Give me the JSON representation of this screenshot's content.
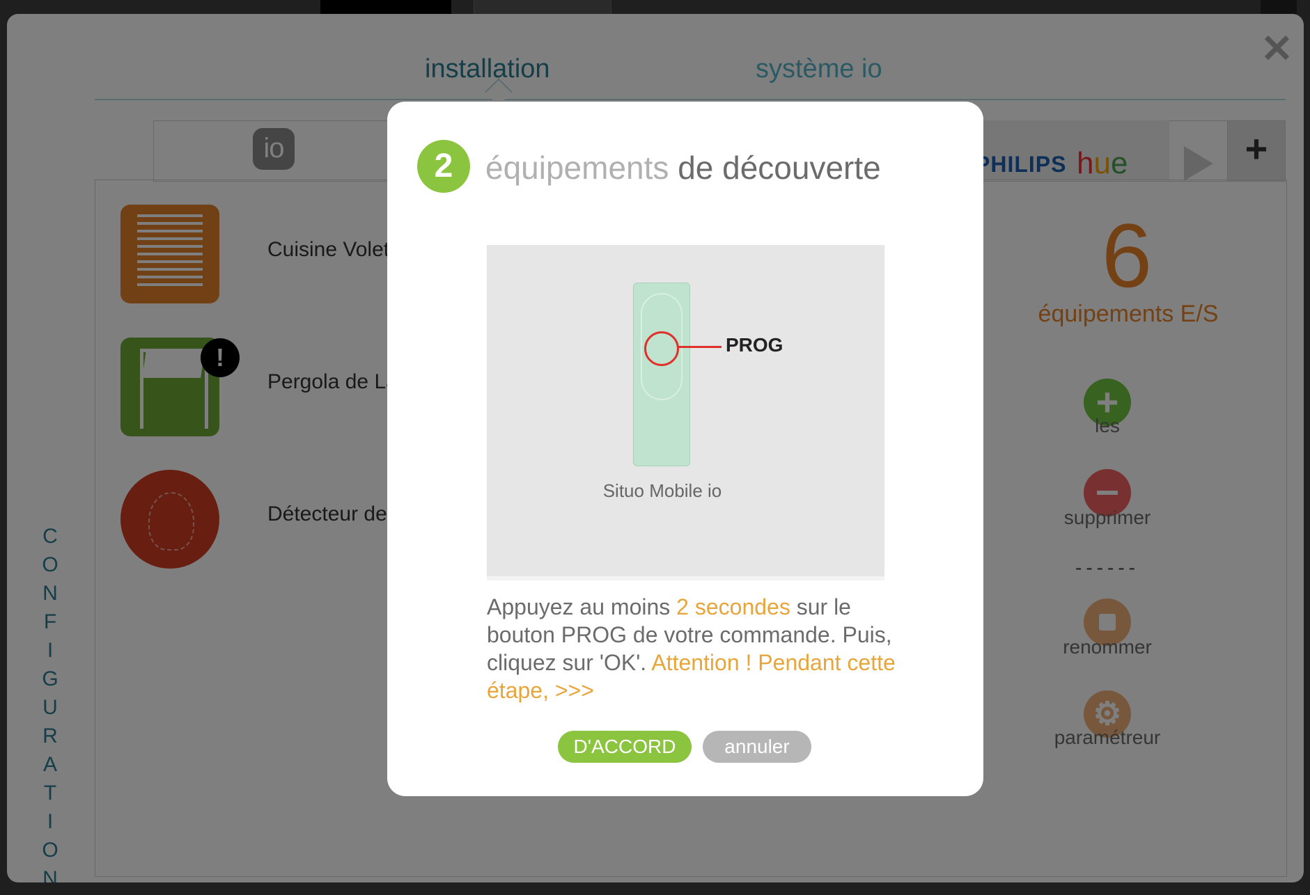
{
  "tabs": {
    "installation": "installation",
    "system": "système io"
  },
  "protocols": {
    "io_logo": "io",
    "philips": "PHILIPS",
    "hue": [
      "h",
      "u",
      "e"
    ],
    "add": "+"
  },
  "sidebar_vertical": [
    "C",
    "O",
    "N",
    "F",
    "I",
    "G",
    "U",
    "R",
    "A",
    "T",
    "I",
    "O",
    "N"
  ],
  "devices": [
    {
      "label": "Cuisine Volet"
    },
    {
      "label": "Pergola de La"
    },
    {
      "label": "Détecteur de"
    }
  ],
  "badge": "!",
  "summary": {
    "count": "6",
    "label": "équipements E/S"
  },
  "actions": {
    "add_label": "les",
    "delete_label": "supprimer",
    "separator": "------",
    "rename_label": "renommer",
    "settings_label": "paramétreur"
  },
  "dialog": {
    "step": "2",
    "title_part1": "équipements",
    "title_part2": "de découverte",
    "image_prog": "PROG",
    "image_caption": "Situo Mobile io",
    "text": {
      "p1": "Appuyez au moins ",
      "h1": "2 secondes",
      "p2": " sur le bouton PROG de votre commande. Puis, cliquez sur 'OK'. ",
      "h2": "Attention ! Pendant cette étape,   >>>"
    },
    "ok": "D'ACCORD",
    "cancel": "annuler"
  },
  "colors": {
    "accent_orange": "#e8822a",
    "accent_green": "#8bc43f",
    "teal": "#2a7d93"
  },
  "icons": {
    "close": "close-icon",
    "add": "plus-circle-icon",
    "delete": "minus-circle-icon",
    "rename": "stop-square-icon",
    "settings": "gear-icon",
    "alert": "exclamation-icon"
  }
}
